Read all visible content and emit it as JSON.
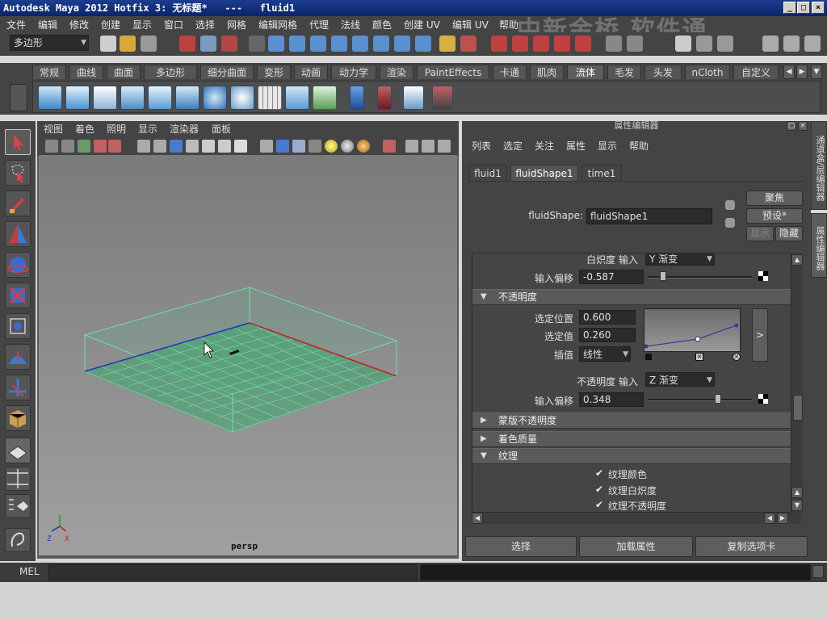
{
  "title_bar": {
    "text": "Autodesk Maya 2012 Hotfix 3: 无标题*   ---   fluid1"
  },
  "watermark": "中新金桥  软件通",
  "menu": [
    "文件",
    "编辑",
    "修改",
    "创建",
    "显示",
    "窗口",
    "选择",
    "网格",
    "编辑网格",
    "代理",
    "法线",
    "颜色",
    "创建 UV",
    "编辑 UV",
    "帮助"
  ],
  "status_line": {
    "mode": "多边形"
  },
  "shelf_tabs": [
    "常规",
    "曲线",
    "曲面",
    "多边形",
    "细分曲面",
    "变形",
    "动画",
    "动力学",
    "渲染",
    "PaintEffects",
    "卡通",
    "肌肉",
    "流体",
    "毛发",
    "头发",
    "nCloth",
    "自定义"
  ],
  "shelf_active": "流体",
  "viewport": {
    "menu": [
      "视图",
      "着色",
      "照明",
      "显示",
      "渲染器",
      "面板"
    ],
    "camera_label": "persp"
  },
  "attribute_editor": {
    "title": "属性编辑器",
    "menu": [
      "列表",
      "选定",
      "关注",
      "属性",
      "显示",
      "帮助"
    ],
    "tabs": [
      "fluid1",
      "fluidShape1",
      "time1"
    ],
    "active_tab": "fluidShape1",
    "node_label": "fluidShape:",
    "node_name": "fluidShape1",
    "buttons": {
      "focus": "聚焦",
      "presets": "预设*",
      "show": "显示",
      "hide": "隐藏"
    },
    "incandescence_input_label": "白炽度 输入",
    "incandescence_input_value": "Y 渐变",
    "input_bias_label": "输入偏移",
    "incandescence_bias": "-0.587",
    "incandescence_bias_level": 0.14,
    "opacity_section": "不透明度",
    "selected_position_label": "选定位置",
    "selected_position": "0.600",
    "selected_value_label": "选定值",
    "selected_value": "0.260",
    "interpolation_label": "插值",
    "interpolation": "线性",
    "ramp_expand": ">",
    "opacity_input_label": "不透明度 输入",
    "opacity_input_value": "Z 渐变",
    "opacity_bias": "0.348",
    "opacity_bias_level": 0.67,
    "sections": [
      "蒙版不透明度",
      "着色质量",
      "纹理"
    ],
    "texture_checks": [
      "纹理颜色",
      "纹理白炽度",
      "纹理不透明度"
    ],
    "bottom_buttons": [
      "选择",
      "加载属性",
      "复制选项卡"
    ]
  },
  "side_tabs": [
    "通道盒/层编辑器",
    "属性编辑器"
  ],
  "command_line": {
    "label": "MEL"
  },
  "axis": {
    "x": "X",
    "z": "Z"
  }
}
